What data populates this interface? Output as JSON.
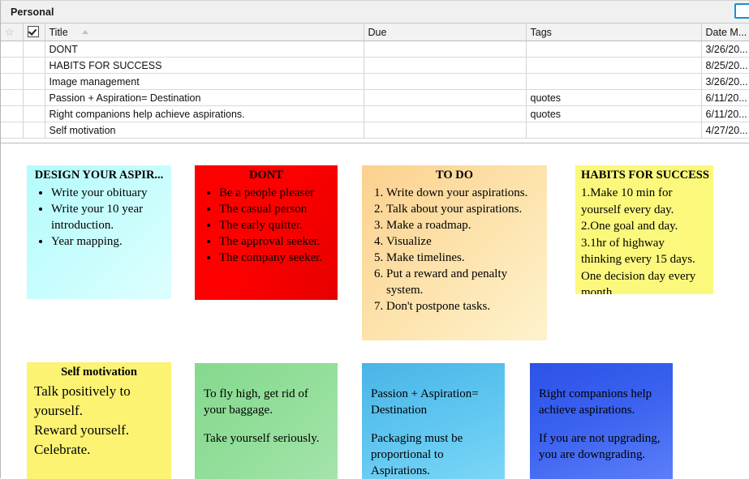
{
  "window": {
    "title": "Personal"
  },
  "table": {
    "columns": [
      {
        "key": "star",
        "label": "",
        "icon": "star-icon"
      },
      {
        "key": "check",
        "label": "",
        "icon": "checkbox-icon"
      },
      {
        "key": "title",
        "label": "Title",
        "sort": "ascending"
      },
      {
        "key": "due",
        "label": "Due"
      },
      {
        "key": "tags",
        "label": "Tags"
      },
      {
        "key": "date",
        "label": "Date M..."
      }
    ],
    "rows": [
      {
        "title": "DONT",
        "due": "",
        "tags": "",
        "date": "3/26/20...",
        "state": "alt"
      },
      {
        "title": "HABITS FOR SUCCESS",
        "due": "",
        "tags": "",
        "date": "8/25/20...",
        "state": "normal"
      },
      {
        "title": "Image management",
        "due": "",
        "tags": "",
        "date": "3/26/20...",
        "state": "focus"
      },
      {
        "title": "Passion + Aspiration= Destination",
        "due": "",
        "tags": "quotes",
        "date": "6/11/20...",
        "state": "selected"
      },
      {
        "title": "Right companions help achieve aspirations.",
        "due": "",
        "tags": "quotes",
        "date": "6/11/20...",
        "state": "normal"
      },
      {
        "title": "Self motivation",
        "due": "",
        "tags": "",
        "date": "4/27/20...",
        "state": "normal"
      }
    ]
  },
  "notes": {
    "design": {
      "title": "DESIGN YOUR ASPIR...",
      "items": [
        "Write your obituary",
        "Write your 10 year introduction.",
        "Year mapping."
      ],
      "color": "#b4fcfc"
    },
    "dont": {
      "title": "DONT",
      "items": [
        "Be a people pleaser",
        "The casual person",
        "The early quitter.",
        "The approval seeker.",
        "The company seeker."
      ],
      "color": "#fb0000"
    },
    "todo": {
      "title": "TO DO",
      "items": [
        "Write down your aspirations.",
        "Talk about your aspirations.",
        "Make a roadmap.",
        "Visualize",
        "Make timelines.",
        "Put a reward and penalty system.",
        "Don't postpone tasks."
      ],
      "color": "#fbd18d"
    },
    "habits": {
      "title": "HABITS FOR SUCCESS",
      "lines": [
        "1.Make 10 min for",
        "yourself every day.",
        "2.One goal and day.",
        "3.1hr of highway",
        "thinking every 15 days.",
        "One decision day every",
        "month."
      ],
      "color": "#fbf87c"
    },
    "self": {
      "title": "Self motivation",
      "lines": [
        "Talk positively to",
        "yourself.",
        "Reward yourself.",
        "Celebrate."
      ],
      "color": "#fcf372"
    },
    "fly": {
      "paragraphs": [
        "To fly high, get rid of your baggage.",
        "Take yourself seriously."
      ],
      "color": "#85d98e"
    },
    "passion": {
      "paragraphs": [
        "Passion + Aspiration= Destination",
        "Packaging must be proportional to Aspirations."
      ],
      "color": "#4ab4e6"
    },
    "right": {
      "paragraphs": [
        "Right companions help achieve aspirations.",
        "If you are not upgrading, you are downgrading."
      ],
      "color": "#2d52e8"
    }
  }
}
